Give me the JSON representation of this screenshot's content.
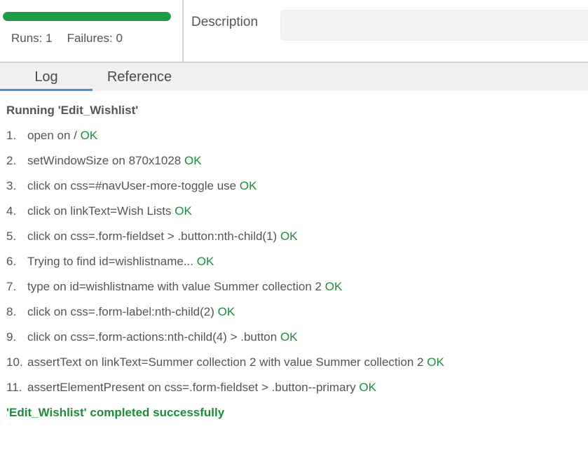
{
  "runner": {
    "progress": 1.0,
    "runs_label": "Runs: 1",
    "failures_label": "Failures: 0"
  },
  "description": {
    "label": "Description",
    "value": ""
  },
  "tabs": [
    {
      "label": "Log",
      "active": true
    },
    {
      "label": "Reference",
      "active": false
    }
  ],
  "log": {
    "header": "Running 'Edit_Wishlist'",
    "ok_label": "OK",
    "entries": [
      {
        "num": "1.",
        "text": "open on /"
      },
      {
        "num": "2.",
        "text": "setWindowSize on 870x1028"
      },
      {
        "num": "3.",
        "text": "click on css=#navUser-more-toggle use"
      },
      {
        "num": "4.",
        "text": "click on linkText=Wish Lists"
      },
      {
        "num": "5.",
        "text": "click on css=.form-fieldset > .button:nth-child(1)"
      },
      {
        "num": "6.",
        "text": "Trying to find id=wishlistname..."
      },
      {
        "num": "7.",
        "text": "type on id=wishlistname with value Summer collection 2"
      },
      {
        "num": "8.",
        "text": "click on css=.form-label:nth-child(2)"
      },
      {
        "num": "9.",
        "text": "click on css=.form-actions:nth-child(4) > .button"
      },
      {
        "num": "10.",
        "text": "assertText on linkText=Summer collection 2 with value Summer collection 2"
      },
      {
        "num": "11.",
        "text": "assertElementPresent on css=.form-fieldset > .button--primary"
      }
    ],
    "footer": "'Edit_Wishlist' completed successfully"
  },
  "colors": {
    "progress": "#1f9a49",
    "ok": "#1f8a3e",
    "tab_accent": "#4a90d9"
  }
}
